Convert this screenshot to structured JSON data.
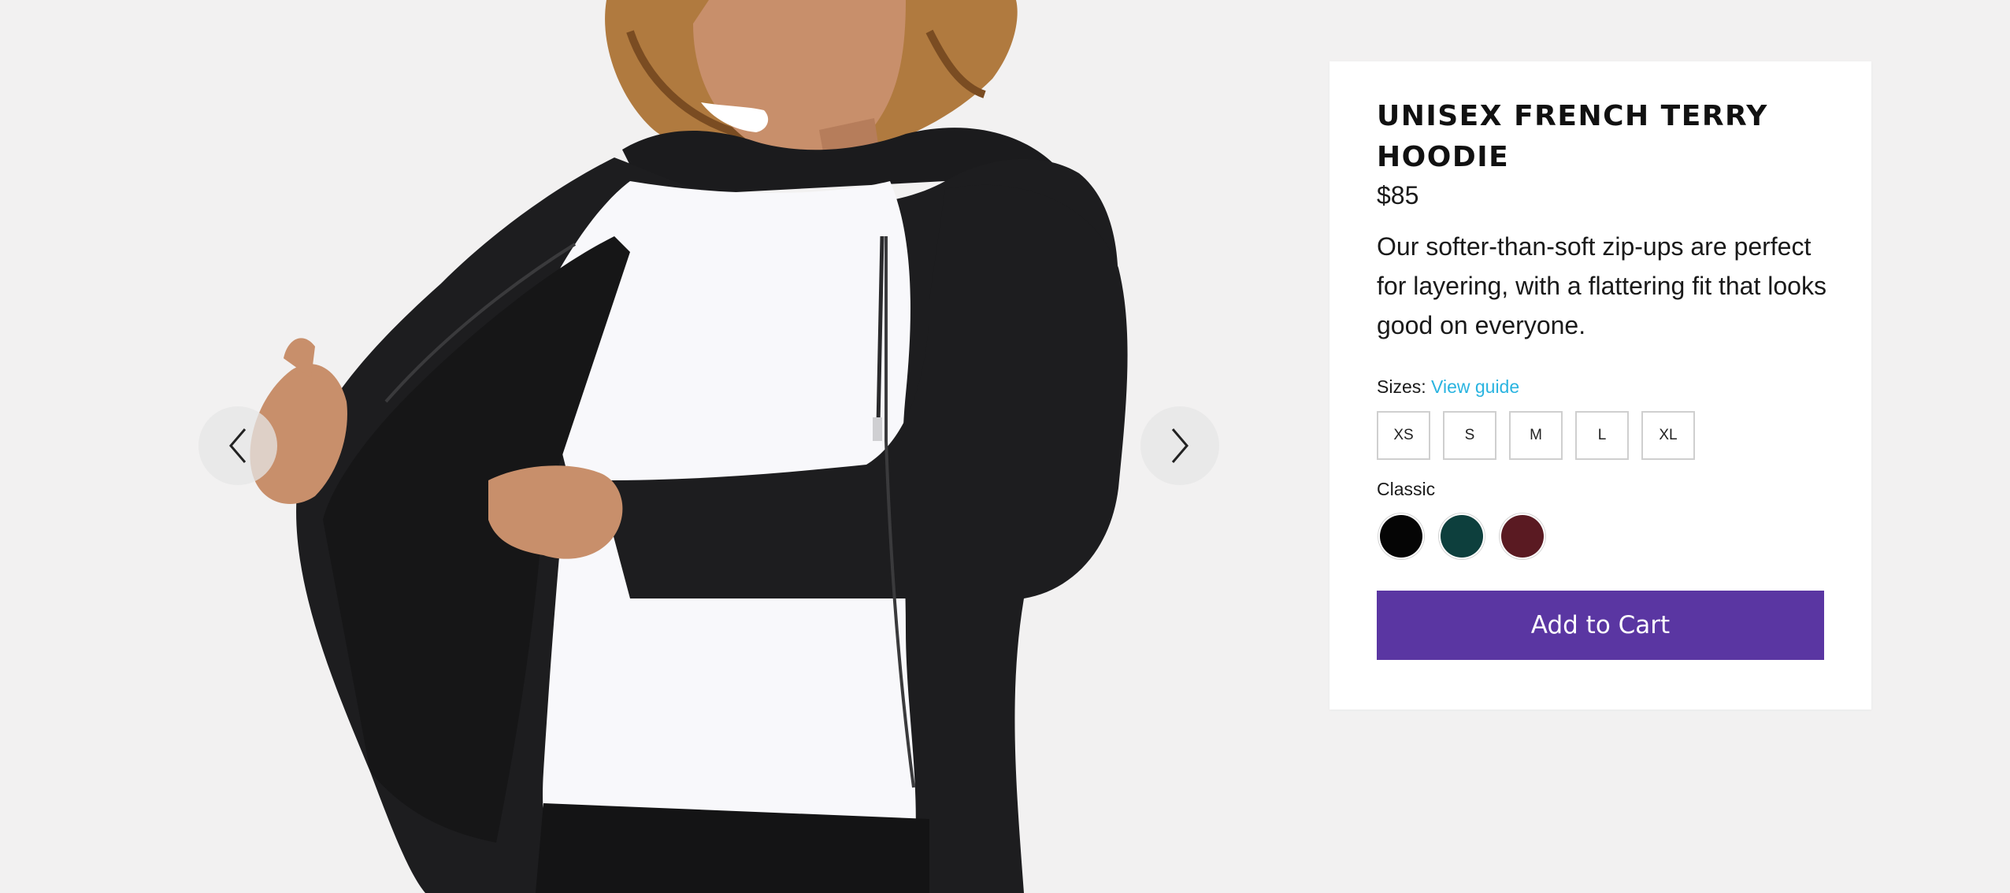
{
  "product": {
    "title": "UNISEX FRENCH TERRY HOODIE",
    "price": "$85",
    "description": "Our softer-than-soft zip-ups are perfect for layering, with a flattering fit that looks good on everyone."
  },
  "sizes": {
    "label": "Sizes:",
    "guide_link": "View guide",
    "options": [
      "XS",
      "S",
      "M",
      "L",
      "XL"
    ]
  },
  "colors": {
    "label": "Classic",
    "swatches": [
      "#050505",
      "#0d3f3d",
      "#5a1a22"
    ]
  },
  "cart": {
    "button_label": "Add to Cart",
    "accent": "#5a36a2"
  },
  "gallery": {
    "prev_icon": "chevron-left-icon",
    "next_icon": "chevron-right-icon"
  }
}
